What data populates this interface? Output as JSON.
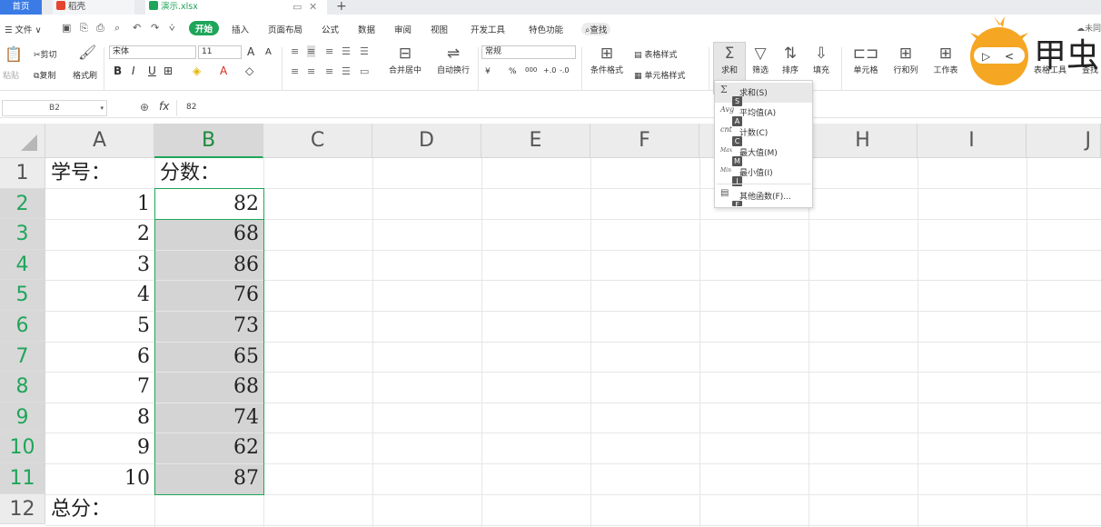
{
  "tabs": {
    "home": "首页",
    "daoke": "稻壳",
    "doc": "演示.xlsx",
    "new_tab": "+"
  },
  "menu": {
    "file": "文件",
    "items": [
      "开始",
      "插入",
      "页面布局",
      "公式",
      "数据",
      "审阅",
      "视图",
      "开发工具",
      "特色功能"
    ],
    "search": "查找",
    "cloud": "未同"
  },
  "ribbon": {
    "paste": "粘贴",
    "cut": "剪切",
    "copy": "复制",
    "format_painter": "格式刷",
    "font_name": "宋体",
    "font_size": "11",
    "bold": "B",
    "italic": "I",
    "underline": "U",
    "grow_font": "A",
    "shrink_font": "A",
    "merge_center": "合并居中",
    "wrap_text": "自动换行",
    "number_format": "常规",
    "currency": "¥",
    "percent": "%",
    "thousands": "000",
    "conditional_format": "条件格式",
    "table_style": "表格样式",
    "cell_style": "单元格样式",
    "sum": "求和",
    "filter": "筛选",
    "sort": "排序",
    "fill": "填充",
    "cell": "单元格",
    "row_col": "行和列",
    "worksheet": "工作表",
    "table_tools": "表格工具",
    "find": "查找"
  },
  "logo": {
    "text": "甲虫"
  },
  "formula_bar": {
    "name_box": "B2",
    "fx": "fx",
    "value": "82"
  },
  "sheet": {
    "columns": [
      "A",
      "B",
      "C",
      "D",
      "E",
      "F",
      "G",
      "H",
      "I",
      "J"
    ],
    "rows": [
      "1",
      "2",
      "3",
      "4",
      "5",
      "6",
      "7",
      "8",
      "9",
      "10",
      "11",
      "12"
    ],
    "header_a": "学号：",
    "header_b": "分数：",
    "ids": [
      "1",
      "2",
      "3",
      "4",
      "5",
      "6",
      "7",
      "8",
      "9",
      "10"
    ],
    "scores": [
      "82",
      "68",
      "86",
      "76",
      "73",
      "65",
      "68",
      "74",
      "62",
      "87"
    ],
    "total_label": "总分："
  },
  "sum_dropdown": {
    "items": [
      {
        "icon": "Σ",
        "label": "求和(S)",
        "key": "S"
      },
      {
        "icon": "Avg",
        "label": "平均值(A)",
        "key": "A"
      },
      {
        "icon": "cnt",
        "label": "计数(C)",
        "key": "C"
      },
      {
        "icon": "Max",
        "label": "最大值(M)",
        "key": "M"
      },
      {
        "icon": "Min",
        "label": "最小值(I)",
        "key": "I"
      }
    ],
    "more": {
      "label": "其他函数(F)...",
      "key": "F"
    }
  },
  "colors": {
    "accent_green": "#1fa55a",
    "home_tab_blue": "#3b7be5",
    "logo_orange": "#f5a623"
  }
}
